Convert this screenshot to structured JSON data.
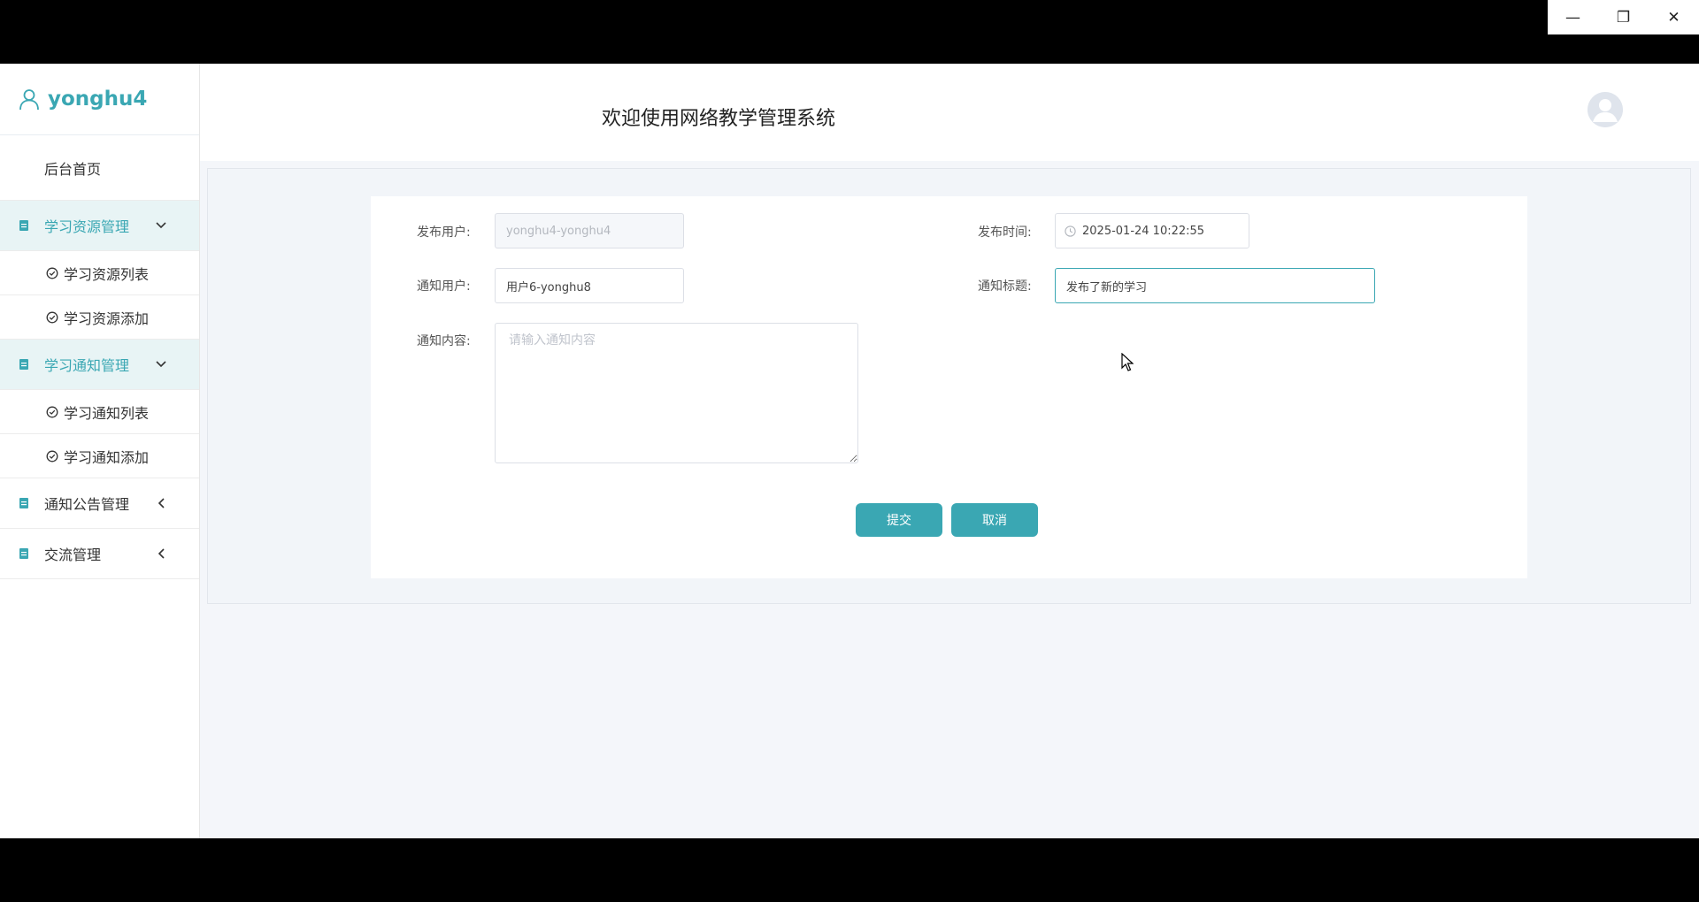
{
  "window": {
    "minimize_glyph": "—",
    "restore_glyph": "❐",
    "close_glyph": "✕"
  },
  "sidebar": {
    "username": "yonghu4",
    "home_label": "后台首页",
    "groups": [
      {
        "label": "学习资源管理",
        "expanded": true,
        "items": [
          "学习资源列表",
          "学习资源添加"
        ]
      },
      {
        "label": "学习通知管理",
        "expanded": true,
        "items": [
          "学习通知列表",
          "学习通知添加"
        ]
      },
      {
        "label": "通知公告管理",
        "expanded": false,
        "items": []
      },
      {
        "label": "交流管理",
        "expanded": false,
        "items": []
      }
    ]
  },
  "header": {
    "title": "欢迎使用网络教学管理系统"
  },
  "form": {
    "publisher_label": "发布用户:",
    "publisher_value": "yonghu4-yonghu4",
    "publish_time_label": "发布时间:",
    "publish_time_value": "2025-01-24 10:22:55",
    "notify_user_label": "通知用户:",
    "notify_user_value": "用户6-yonghu8",
    "notify_title_label": "通知标题:",
    "notify_title_value": "发布了新的学习",
    "notify_content_label": "通知内容:",
    "notify_content_placeholder": "请输入通知内容",
    "submit_label": "提交",
    "cancel_label": "取消"
  },
  "colors": {
    "accent": "#3aa7b3",
    "active_bg": "#e8f4f5"
  }
}
